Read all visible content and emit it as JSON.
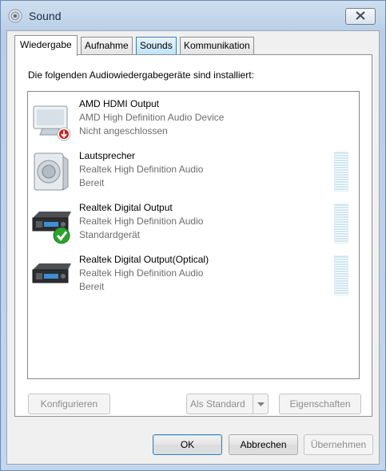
{
  "window": {
    "title": "Sound"
  },
  "tabs": [
    {
      "label": "Wiedergabe"
    },
    {
      "label": "Aufnahme"
    },
    {
      "label": "Sounds"
    },
    {
      "label": "Kommunikation"
    }
  ],
  "playback": {
    "instruction": "Die folgenden Audiowiedergabegeräte sind installiert:",
    "devices": [
      {
        "name": "AMD HDMI Output",
        "description": "AMD High Definition Audio Device",
        "status": "Nicht angeschlossen",
        "icon": "hdmi-monitor-icon",
        "badge": "disconnected-arrow-icon"
      },
      {
        "name": "Lautsprecher",
        "description": "Realtek High Definition Audio",
        "status": "Bereit",
        "icon": "speaker-icon"
      },
      {
        "name": "Realtek Digital Output",
        "description": "Realtek High Definition Audio",
        "status": "Standardgerät",
        "icon": "digital-output-device-icon",
        "badge": "default-check-icon"
      },
      {
        "name": "Realtek Digital Output(Optical)",
        "description": "Realtek High Definition Audio",
        "status": "Bereit",
        "icon": "digital-output-device-icon"
      }
    ],
    "buttons": {
      "configure": "Konfigurieren",
      "set_default": "Als Standard",
      "properties": "Eigenschaften"
    }
  },
  "dialog_buttons": {
    "ok": "OK",
    "cancel": "Abbrechen",
    "apply": "Übernehmen"
  },
  "colors": {
    "accent": "#3c7fb1",
    "check_green": "#2fa12f",
    "badge_red": "#c8201c"
  }
}
